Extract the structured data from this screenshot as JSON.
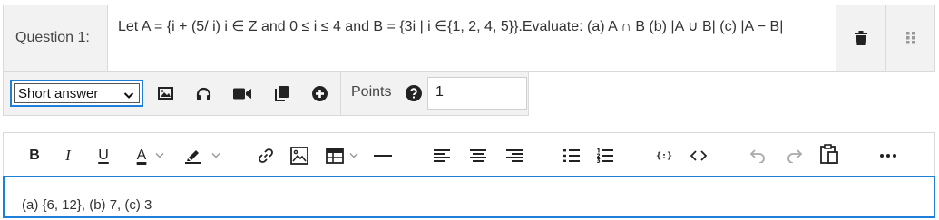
{
  "question": {
    "label": "Question 1:",
    "text": "Let A = {i + (5/ i)  i ∈ Z and 0 ≤ i ≤ 4 and B = {3i | i ∈{1, 2, 4, 5}}.Evaluate: (a) A ∩ B (b) |A ∪ B| (c) |A − B|"
  },
  "answer_type": {
    "selected": "Short answer"
  },
  "points": {
    "label": "Points",
    "value": "1"
  },
  "editor": {
    "toolbar": {
      "bold": "B",
      "italic": "I",
      "underline": "U",
      "font_color": "A",
      "code_sample": "{:}"
    },
    "content": "(a) {6, 12}, (b) 7, (c) 3"
  },
  "colors": {
    "accent": "#1e7fd9",
    "panel_bg": "#f2f2f2",
    "border": "#d9d9d9"
  }
}
